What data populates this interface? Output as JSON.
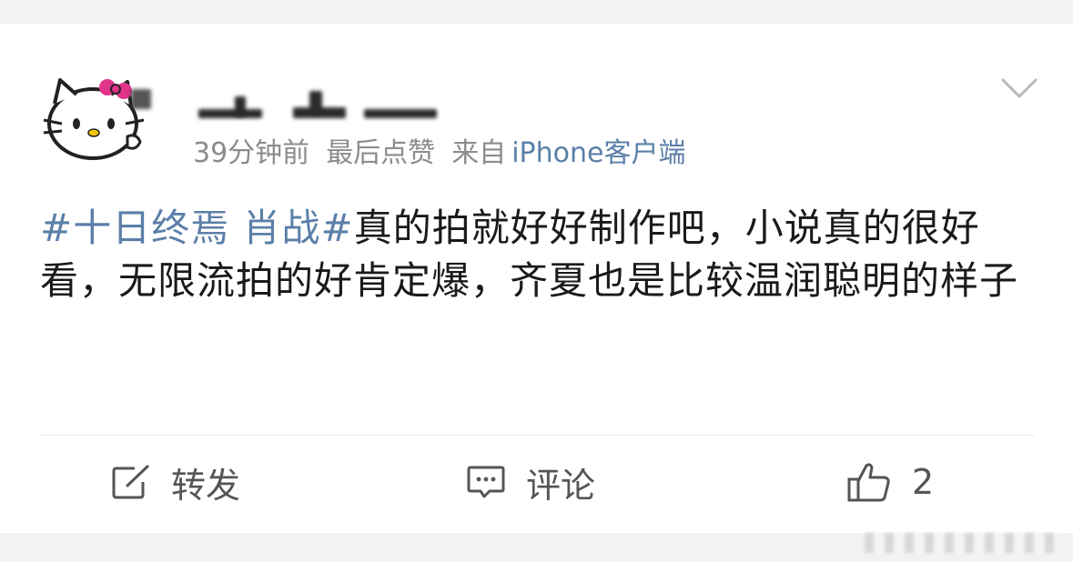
{
  "post": {
    "author": {
      "avatar_icon": "hello-kitty-avatar-icon"
    },
    "meta": {
      "time": "39分钟前",
      "liked_label": "最后点赞",
      "from_label": "来自",
      "source": "iPhone客户端"
    },
    "content": {
      "hashtag": "#十日终焉 肖战#",
      "text": "真的拍就好好制作吧，小说真的很好看，无限流拍的好肯定爆，齐夏也是比较温润聪明的样子"
    },
    "actions": {
      "repost_label": "转发",
      "comment_label": "评论",
      "like_count": "2"
    },
    "colors": {
      "link": "#5b7fa8",
      "meta": "#8c8c8c",
      "text": "#1a1a1a",
      "page_bg": "#f2f2f2"
    }
  }
}
